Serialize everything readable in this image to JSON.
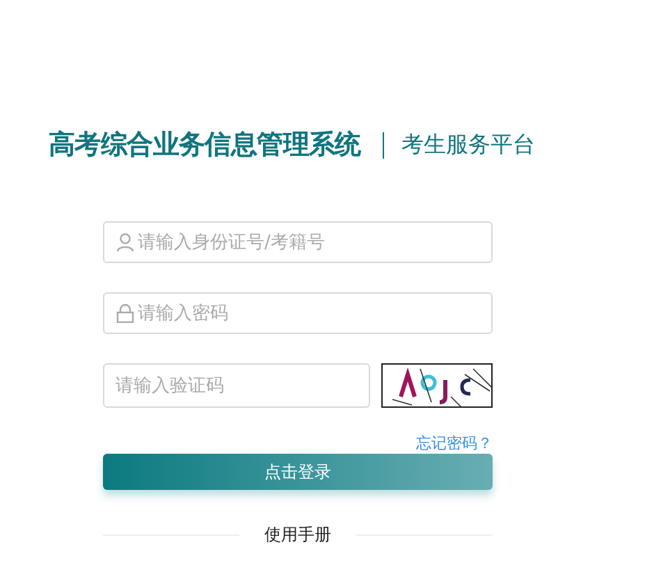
{
  "header": {
    "title": "高考综合业务信息管理系统",
    "subtitle": "考生服务平台"
  },
  "fields": [
    {
      "kind": "user",
      "placeholder": "请输入身份证号/考籍号"
    },
    {
      "kind": "password",
      "placeholder": "请输入密码"
    }
  ],
  "captcha": {
    "placeholder": "请输入验证码"
  },
  "forgot_link": "忘记密码？",
  "login_button": "点击登录",
  "manual_link": "使用手册"
}
